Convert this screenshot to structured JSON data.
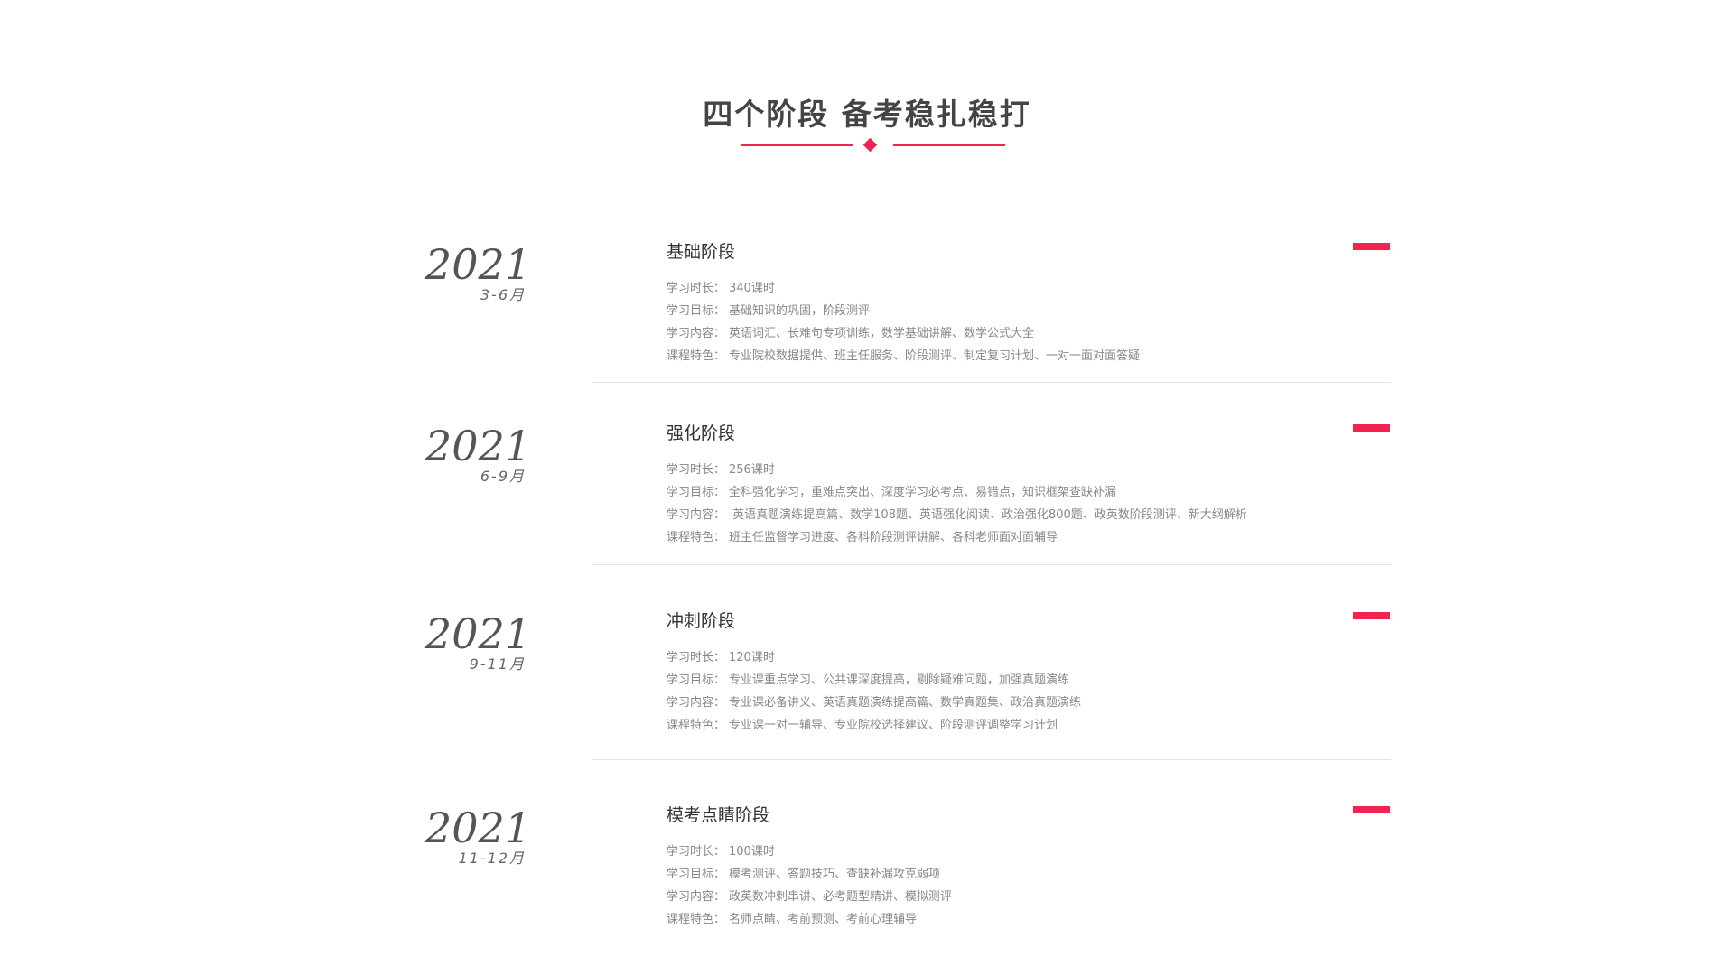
{
  "header": {
    "title": "四个阶段  备考稳扎稳打"
  },
  "colors": {
    "accent": "#f0244e",
    "axis": "#dddddd",
    "text_muted": "#888888"
  },
  "stages": [
    {
      "year": "2021",
      "months": "3-6月",
      "name": "基础阶段",
      "details": [
        {
          "label": "学习时长：",
          "value": "340课时"
        },
        {
          "label": "学习目标：",
          "value": "基础知识的巩固，阶段测评"
        },
        {
          "label": "学习内容：",
          "value": "英语词汇、长难句专项训练，数学基础讲解、数学公式大全"
        },
        {
          "label": "课程特色：",
          "value": "专业院校数据提供、班主任服务、阶段测评、制定复习计划、一对一面对面答疑"
        }
      ]
    },
    {
      "year": "2021",
      "months": "6-9月",
      "name": "强化阶段",
      "details": [
        {
          "label": "学习时长：",
          "value": "256课时"
        },
        {
          "label": "学习目标：",
          "value": "全科强化学习，重难点突出、深度学习必考点、易错点，知识框架查缺补漏"
        },
        {
          "label": "学习内容：",
          "value": " 英语真题演练提高篇、数学108题、英语强化阅读、政治强化800题、政英数阶段测评、新大纲解析"
        },
        {
          "label": "课程特色：",
          "value": "班主任监督学习进度、各科阶段测评讲解、各科老师面对面辅导"
        }
      ]
    },
    {
      "year": "2021",
      "months": "9-11月",
      "name": "冲刺阶段",
      "details": [
        {
          "label": "学习时长：",
          "value": "120课时"
        },
        {
          "label": "学习目标：",
          "value": "专业课重点学习、公共课深度提高，剔除疑难问题，加强真题演练"
        },
        {
          "label": "学习内容：",
          "value": "专业课必备讲义、英语真题演练提高篇、数学真题集、政治真题演练"
        },
        {
          "label": "课程特色：",
          "value": "专业课一对一辅导、专业院校选择建议、阶段测评调整学习计划"
        }
      ]
    },
    {
      "year": "2021",
      "months": "11-12月",
      "name": "模考点睛阶段",
      "details": [
        {
          "label": "学习时长：",
          "value": "100课时"
        },
        {
          "label": "学习目标：",
          "value": "模考测评、答题技巧、查缺补漏攻克弱项"
        },
        {
          "label": "学习内容：",
          "value": "政英数冲刺串讲、必考题型精讲、模拟测评"
        },
        {
          "label": "课程特色：",
          "value": "名师点睛、考前预测、考前心理辅导"
        }
      ]
    }
  ]
}
